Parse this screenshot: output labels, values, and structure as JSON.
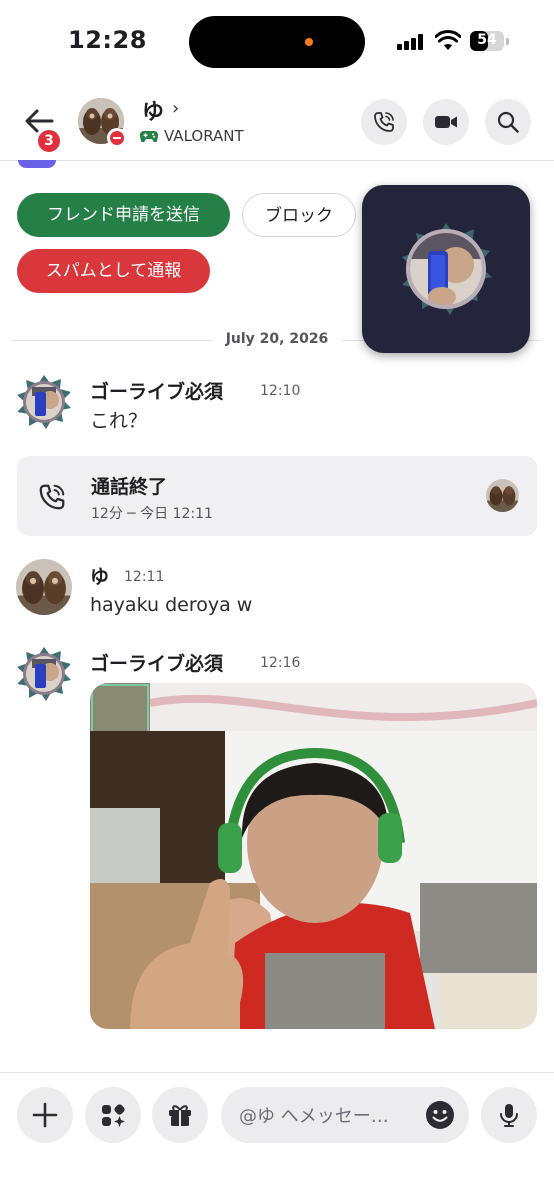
{
  "status_bar": {
    "time": "12:28",
    "battery": "54",
    "battery_level_percent": 54
  },
  "header": {
    "back_badge": "3",
    "name": "ゆ",
    "chevron": "›",
    "activity": "VALORANT",
    "icons": [
      "back-arrow-icon",
      "gamepad-icon",
      "phone-call-icon",
      "video-camera-icon",
      "search-icon"
    ]
  },
  "actions": {
    "friend_request": "フレンド申請を送信",
    "block": "ブロック",
    "report_spam": "スパムとして通報"
  },
  "date_separator": "July 20, 2026",
  "messages": [
    {
      "author": "ゴーライブ必須",
      "time": "12:10",
      "text": "これ？"
    },
    {
      "author": "ゆ",
      "time": "12:11",
      "text": "hayaku deroya w"
    },
    {
      "author": "ゴーライブ必須",
      "time": "12:16"
    }
  ],
  "call": {
    "title": "通話終了",
    "subtitle": "12分 ─ 今日 12:11"
  },
  "composer": {
    "placeholder": "@ゆ へメッセー…",
    "icons": [
      "plus-icon",
      "apps-icon",
      "gift-icon",
      "emoji-icon",
      "microphone-icon"
    ]
  },
  "colors": {
    "green": "#248046",
    "red": "#da373c",
    "badge": "#e0303e",
    "accent": "#6a62e6"
  }
}
